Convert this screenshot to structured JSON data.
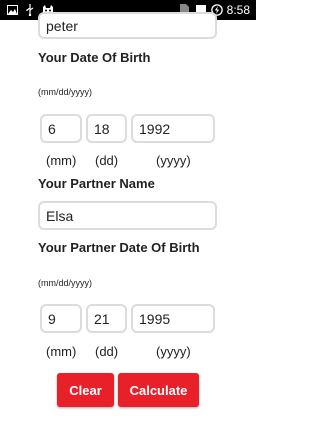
{
  "status_bar": {
    "time": "8:58",
    "left_icons": [
      "image-icon",
      "usb-icon",
      "cat-icon"
    ],
    "right_icons": [
      "sim-icon",
      "signal-icon",
      "battery-charging-icon"
    ]
  },
  "form": {
    "name_value": "peter",
    "dob_heading": "Your Date Of Birth",
    "dob_format": "(mm/dd/yyyy)",
    "dob": {
      "mm": "6",
      "dd": "18",
      "yyyy": "1992"
    },
    "units": {
      "mm": "(mm)",
      "dd": "(dd)",
      "yyyy": "(yyyy)"
    },
    "partner_name_heading": "Your Partner Name",
    "partner_name_value": "Elsa",
    "partner_dob_heading": "Your Partner Date Of Birth",
    "partner_dob_format": "(mm/dd/yyyy)",
    "partner_dob": {
      "mm": "9",
      "dd": "21",
      "yyyy": "1995"
    }
  },
  "buttons": {
    "clear_label": "Clear",
    "calculate_label": "Calculate",
    "accent_color": "#e8202a"
  }
}
